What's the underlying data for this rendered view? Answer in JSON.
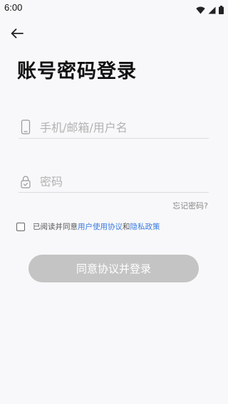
{
  "status_bar": {
    "time": "6:00"
  },
  "header": {
    "back_icon": "arrow-left-icon",
    "title": "账号密码登录"
  },
  "form": {
    "account": {
      "icon": "phone-icon",
      "placeholder": "手机/邮箱/用户名",
      "value": ""
    },
    "password": {
      "icon": "lock-icon",
      "placeholder": "密码",
      "value": ""
    },
    "forgot_label": "忘记密码?"
  },
  "agreement": {
    "checked": false,
    "prefix": "已阅读并同意",
    "user_agreement": "用户使用协议",
    "conjunction": "和",
    "privacy_policy": "隐私政策"
  },
  "login_button_label": "同意协议并登录",
  "colors": {
    "background": "#f8f8fa",
    "link": "#3a7be0",
    "button_disabled": "#c4c4c4"
  }
}
